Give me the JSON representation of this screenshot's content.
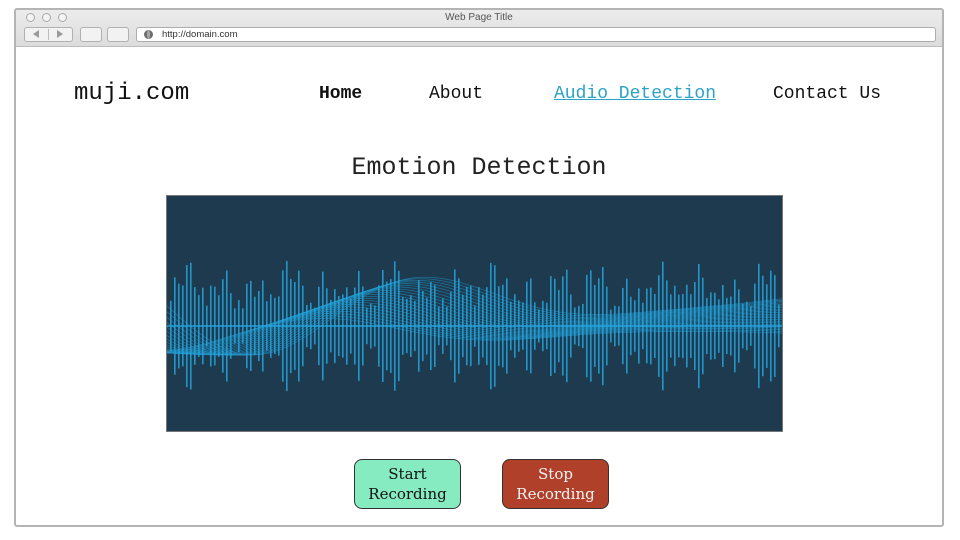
{
  "browser": {
    "window_title": "Web Page Title",
    "url": "http://domain.com"
  },
  "site": {
    "logo": "muji.com",
    "nav": [
      {
        "label": "Home",
        "state": "active"
      },
      {
        "label": "About",
        "state": "normal"
      },
      {
        "label": "Audio Detection",
        "state": "link"
      },
      {
        "label": "Contact Us",
        "state": "normal"
      }
    ]
  },
  "main": {
    "title": "Emotion Detection",
    "visualization": {
      "icon": "audio-waveform",
      "background_color": "#1d3a4e",
      "wave_color": "#23a6df"
    },
    "buttons": {
      "start": {
        "line1": "Start",
        "line2": "Recording",
        "color": "#87ebc1"
      },
      "stop": {
        "line1": "Stop",
        "line2": "Recording",
        "color": "#b1402a"
      }
    }
  }
}
